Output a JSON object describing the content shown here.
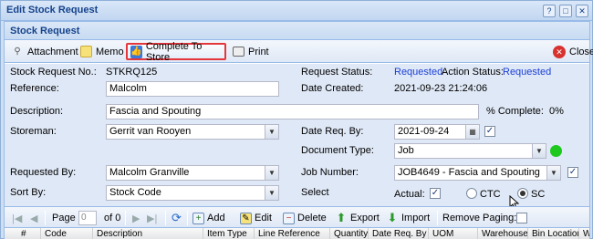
{
  "window": {
    "title": "Edit Stock Request",
    "title_icons": [
      "help-icon",
      "maximize-icon",
      "close-icon"
    ]
  },
  "panel": {
    "title": "Stock Request"
  },
  "toolbar": {
    "attachment": "Attachment",
    "memo": "Memo",
    "complete_to_store": "Complete To Store",
    "print": "Print",
    "close": "Close"
  },
  "form": {
    "stock_request_no_label": "Stock Request No.:",
    "stock_request_no": "STKRQ125",
    "request_status_label": "Request Status:",
    "request_status": "Requested",
    "action_status_label": "Action Status:",
    "action_status": "Requested",
    "reference_label": "Reference:",
    "reference": "Malcolm",
    "date_created_label": "Date Created:",
    "date_created": "2021-09-23 21:24:06",
    "description_label": "Description:",
    "description": "Fascia and Spouting",
    "percent_complete_label": "% Complete:",
    "percent_complete": "0%",
    "storeman_label": "Storeman:",
    "storeman": "Gerrit van Rooyen",
    "date_req_by_label": "Date Req. By:",
    "date_req_by": "2021-09-24",
    "document_type_label": "Document Type:",
    "document_type": "Job",
    "requested_by_label": "Requested By:",
    "requested_by": "Malcolm Granville",
    "job_number_label": "Job Number:",
    "job_number": "JOB4649 - Fascia and Spouting",
    "sort_by_label": "Sort By:",
    "sort_by": "Stock Code",
    "select_label": "Select",
    "actual_label": "Actual:",
    "ctc_label": "CTC",
    "sc_label": "SC"
  },
  "grid_toolbar": {
    "page_label": "Page",
    "page_value": "0",
    "of_label": "of 0",
    "add": "Add",
    "edit": "Edit",
    "delete": "Delete",
    "export": "Export",
    "import": "Import",
    "remove_paging": "Remove Paging:"
  },
  "grid": {
    "columns": [
      "#",
      "Code",
      "Description",
      "Item Type",
      "Line Reference",
      "Quantity",
      "Date Req. By",
      "UOM",
      "Warehouse",
      "Bin Location",
      "Wo"
    ]
  },
  "colors": {
    "status_green": "#1ec81e",
    "highlight_red": "#e4373b",
    "link_blue": "#1a3fd6"
  }
}
